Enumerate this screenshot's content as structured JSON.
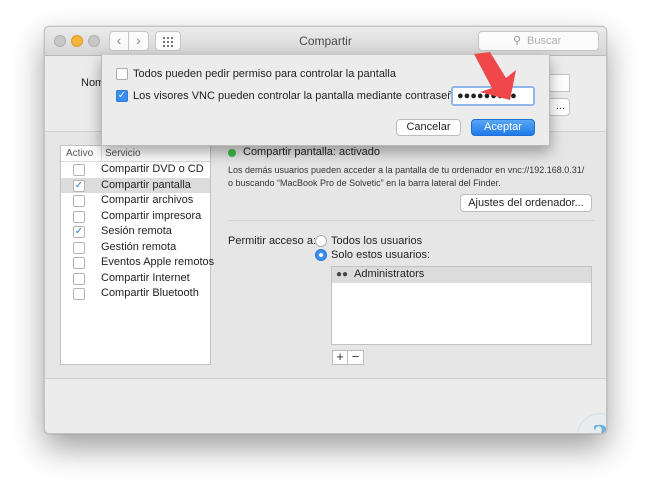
{
  "window": {
    "title": "Compartir"
  },
  "toolbar": {
    "back_glyph": "‹",
    "forward_glyph": "›",
    "search_placeholder": "Buscar",
    "search_icon": "magnifier-icon"
  },
  "header": {
    "name_label": "Nom"
  },
  "services": {
    "col_active": "Activo",
    "col_service": "Servicio",
    "items": [
      {
        "label": "Compartir DVD o CD",
        "checked": false,
        "selected": false
      },
      {
        "label": "Compartir pantalla",
        "checked": true,
        "selected": true
      },
      {
        "label": "Compartir archivos",
        "checked": false,
        "selected": false
      },
      {
        "label": "Compartir impresora",
        "checked": false,
        "selected": false
      },
      {
        "label": "Sesión remota",
        "checked": true,
        "selected": false
      },
      {
        "label": "Gestión remota",
        "checked": false,
        "selected": false
      },
      {
        "label": "Eventos Apple remotos",
        "checked": false,
        "selected": false
      },
      {
        "label": "Compartir Internet",
        "checked": false,
        "selected": false
      },
      {
        "label": "Compartir Bluetooth",
        "checked": false,
        "selected": false
      }
    ]
  },
  "detail": {
    "status": "Compartir pantalla: activado",
    "status_color": "#3bbf4a",
    "description_1": "Los demás usuarios pueden acceder a la pantalla de tu ordenador en vnc://192.168.0.31/",
    "description_2": "o buscando “MacBook Pro de Solvetic” en la barra lateral del Finder.",
    "settings_button": "Ajustes del ordenador...",
    "access_label": "Permitir acceso a:",
    "radio_all": "Todos los usuarios",
    "radio_only": "Solo estos usuarios:",
    "selected_radio": "only",
    "users": [
      "Administrators"
    ],
    "add_glyph": "+",
    "remove_glyph": "−"
  },
  "sheet": {
    "option_permission": "Todos pueden pedir permiso para controlar la pantalla",
    "option_permission_checked": false,
    "option_vnc": "Los visores VNC pueden controlar la pantalla mediante contraseña:",
    "option_vnc_checked": true,
    "password_value": "●●●●●●●●●",
    "cancel_label": "Cancelar",
    "accept_label": "Aceptar",
    "accent_color": "#1f7ae9"
  },
  "annotation": {
    "arrow_color": "#f0474a",
    "arrow_icon": "down-arrow-icon"
  }
}
